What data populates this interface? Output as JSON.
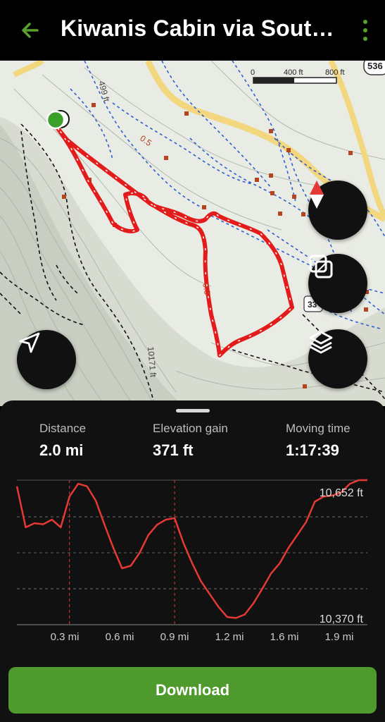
{
  "header": {
    "title": "Kiwanis Cabin via South...",
    "accent": "#5aa02c"
  },
  "map": {
    "scale_labels": [
      "0",
      "400 ft",
      "800 ft"
    ],
    "labels": {
      "top_left": "499 ft",
      "dist_a": "0.5",
      "dist_b": "0.3",
      "bottom": "10171 ft",
      "route_a": "536",
      "route_b": "33",
      "route_c": "330"
    },
    "route_color": "#e31b1b"
  },
  "stats": {
    "distance": {
      "label": "Distance",
      "value": "2.0 mi"
    },
    "elevation": {
      "label": "Elevation gain",
      "value": "371 ft"
    },
    "time": {
      "label": "Moving time",
      "value": "1:17:39"
    }
  },
  "chart_data": {
    "type": "line",
    "title": "",
    "xlabel": "",
    "ylabel": "",
    "y_max_label": "10,652 ft",
    "y_min_label": "10,370 ft",
    "ylim": [
      10370,
      10652
    ],
    "x_ticks": [
      "0.3 mi",
      "0.6 mi",
      "0.9 mi",
      "1.2 mi",
      "1.6 mi",
      "1.9 mi"
    ],
    "x": [
      0.0,
      0.05,
      0.1,
      0.15,
      0.2,
      0.25,
      0.3,
      0.35,
      0.4,
      0.45,
      0.5,
      0.55,
      0.6,
      0.65,
      0.7,
      0.75,
      0.8,
      0.85,
      0.9,
      0.95,
      1.0,
      1.05,
      1.1,
      1.15,
      1.2,
      1.25,
      1.3,
      1.35,
      1.4,
      1.45,
      1.5,
      1.55,
      1.6,
      1.65,
      1.7,
      1.75,
      1.8,
      1.85,
      1.9,
      1.95,
      2.0
    ],
    "values": [
      10640,
      10560,
      10568,
      10566,
      10575,
      10560,
      10620,
      10645,
      10640,
      10612,
      10565,
      10520,
      10480,
      10485,
      10510,
      10545,
      10565,
      10575,
      10578,
      10530,
      10490,
      10455,
      10430,
      10405,
      10385,
      10383,
      10390,
      10412,
      10440,
      10470,
      10490,
      10520,
      10545,
      10570,
      10610,
      10620,
      10622,
      10628,
      10645,
      10652,
      10652
    ],
    "markers_x": [
      0.3,
      0.9
    ],
    "line_color": "#e53935"
  },
  "download": {
    "label": "Download"
  }
}
